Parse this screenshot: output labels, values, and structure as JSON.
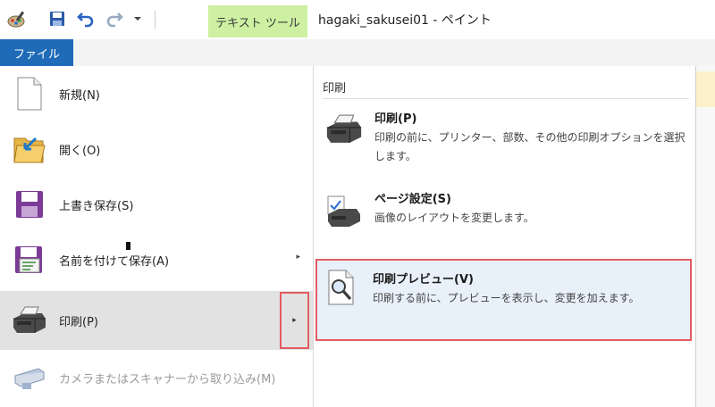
{
  "titlebar": {
    "tool_tab": "テキスト ツール",
    "title": "hagaki_sakusei01 - ペイント",
    "quick_access": [
      "paint-app-icon",
      "save-icon",
      "undo-icon",
      "redo-icon",
      "customize-dropdown-icon"
    ]
  },
  "ribbon": {
    "file_tab": "ファイル"
  },
  "menu": {
    "items": [
      {
        "label": "新規(N)",
        "icon": "new-document-icon"
      },
      {
        "label": "開く(O)",
        "icon": "open-folder-icon"
      },
      {
        "label": "上書き保存(S)",
        "icon": "save-icon"
      },
      {
        "label": "名前を付けて保存(A)",
        "icon": "save-as-icon",
        "has_submenu": true
      },
      {
        "label": "印刷(P)",
        "icon": "printer-icon",
        "has_submenu": true,
        "active": true
      },
      {
        "label": "カメラまたはスキャナーから取り込み(M)",
        "icon": "scanner-icon",
        "disabled": true
      }
    ],
    "submenu_arrow": "▸"
  },
  "print_panel": {
    "title": "印刷",
    "items": [
      {
        "title": "印刷(P)",
        "desc": "印刷の前に、プリンター、部数、その他の印刷オプションを選択します。",
        "icon": "printer-icon"
      },
      {
        "title": "ページ設定(S)",
        "desc": "画像のレイアウトを変更します。",
        "icon": "page-setup-icon"
      },
      {
        "title": "印刷プレビュー(V)",
        "desc": "印刷する前に、プレビューを表示し、変更を加えます。",
        "icon": "print-preview-icon",
        "highlighted": true
      }
    ]
  },
  "colors": {
    "file_tab": "#1f6bb8",
    "tool_tab": "#cdf0a2",
    "highlight_border": "#e35c62",
    "active_row": "#e2e2e2",
    "preview_bg": "#e8f0fa"
  }
}
